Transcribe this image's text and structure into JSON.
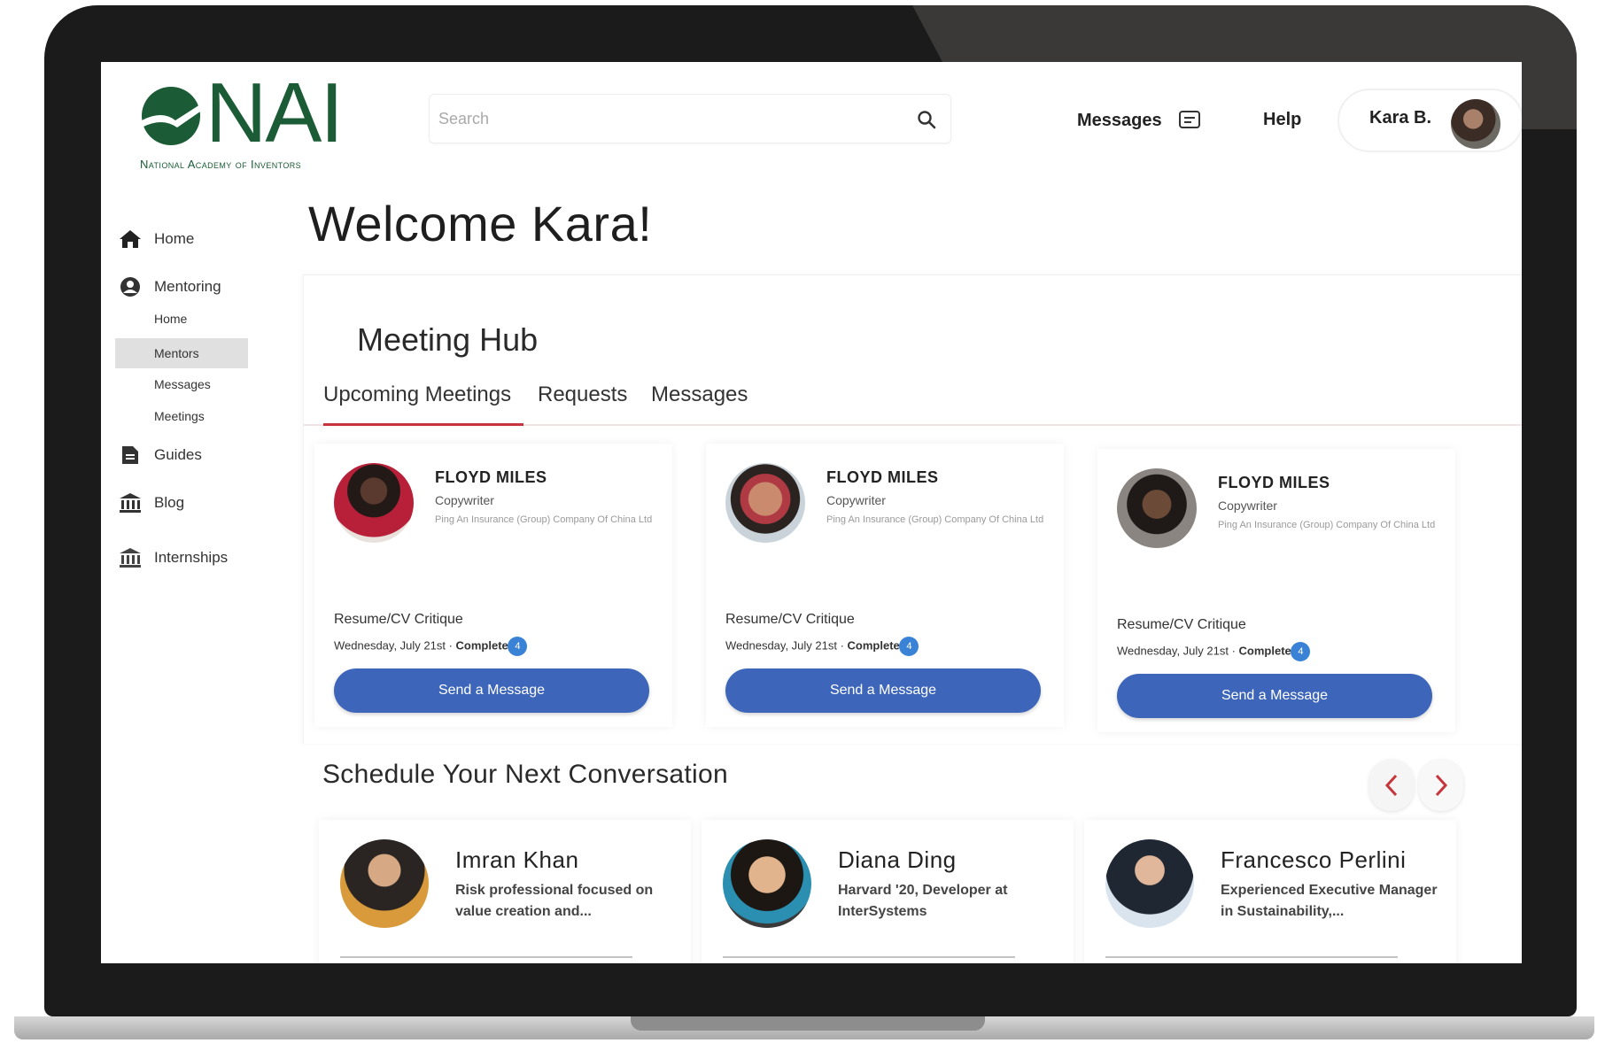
{
  "brand": {
    "logo_text": "NAI",
    "logo_subtitle": "National Academy of Inventors",
    "primary_color": "#1b5c36",
    "accent_color": "#c7343c",
    "button_color": "#3d66ba"
  },
  "search": {
    "placeholder": "Search"
  },
  "topnav": {
    "messages_label": "Messages",
    "help_label": "Help",
    "user_name": "Kara B."
  },
  "sidebar": {
    "items": [
      {
        "label": "Home",
        "icon": "home-icon"
      },
      {
        "label": "Mentoring",
        "icon": "user-circle-icon"
      },
      {
        "label": "Guides",
        "icon": "document-icon"
      },
      {
        "label": "Blog",
        "icon": "institution-icon"
      },
      {
        "label": "Internships",
        "icon": "institution-icon"
      }
    ],
    "mentoring_sub": [
      {
        "label": "Home",
        "active": false
      },
      {
        "label": "Mentors",
        "active": true
      },
      {
        "label": "Messages",
        "active": false
      },
      {
        "label": "Meetings",
        "active": false
      }
    ]
  },
  "main": {
    "welcome": "Welcome Kara!",
    "hub_title": "Meeting Hub",
    "tabs": [
      {
        "label": "Upcoming Meetings",
        "active": true
      },
      {
        "label": "Requests",
        "active": false
      },
      {
        "label": "Messages",
        "active": false
      }
    ],
    "meetings": [
      {
        "name": "FLOYD MILES",
        "role": "Copywriter",
        "org": "Ping An Insurance (Group) Company Of China Ltd",
        "topic": "Resume/CV Critique",
        "date": "Wednesday, July 21st",
        "status": "Complete",
        "badge": "4",
        "button": "Send a Message"
      },
      {
        "name": "FLOYD MILES",
        "role": "Copywriter",
        "org": "Ping An Insurance (Group) Company Of China Ltd",
        "topic": "Resume/CV Critique",
        "date": "Wednesday, July 21st",
        "status": "Complete",
        "badge": "4",
        "button": "Send a Message"
      },
      {
        "name": "FLOYD MILES",
        "role": "Copywriter",
        "org": "Ping An Insurance (Group) Company Of China Ltd",
        "topic": "Resume/CV Critique",
        "date": "Wednesday, July 21st",
        "status": "Complete",
        "badge": "4",
        "button": "Send a Message"
      }
    ],
    "schedule_title": "Schedule Your Next Conversation",
    "people": [
      {
        "name": "Imran Khan",
        "bio": "Risk professional focused on value creation and..."
      },
      {
        "name": "Diana Ding",
        "bio": "Harvard '20, Developer at InterSystems"
      },
      {
        "name": "Francesco Perlini",
        "bio": "Experienced Executive Manager in Sustainability,..."
      }
    ]
  }
}
